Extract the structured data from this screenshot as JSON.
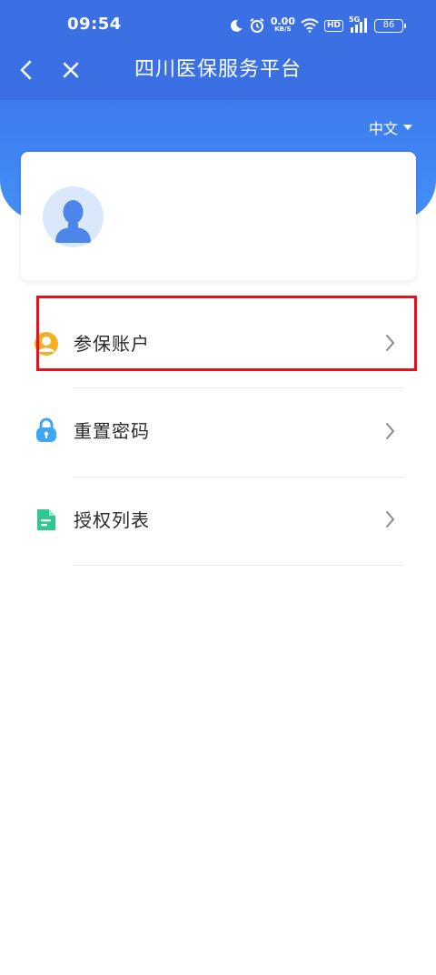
{
  "status_bar": {
    "time": "09:54",
    "net_speed_value": "0.00",
    "net_speed_unit": "KB/S",
    "hd_label": "HD",
    "signal_label": "5G",
    "battery": "86"
  },
  "nav": {
    "title": "四川医保服务平台"
  },
  "language": {
    "current": "中文"
  },
  "menu": {
    "items": [
      {
        "label": "参保账户",
        "icon": "user-circle-icon"
      },
      {
        "label": "重置密码",
        "icon": "lock-icon"
      },
      {
        "label": "授权列表",
        "icon": "document-icon"
      }
    ]
  },
  "colors": {
    "header": "#3b6fe4",
    "highlight": "#e8101b"
  }
}
